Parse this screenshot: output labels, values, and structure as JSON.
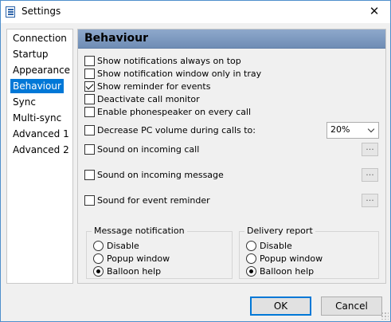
{
  "window": {
    "title": "Settings",
    "close_glyph": "✕"
  },
  "sidebar": {
    "items": [
      {
        "label": "Connection"
      },
      {
        "label": "Startup"
      },
      {
        "label": "Appearance"
      },
      {
        "label": "Behaviour",
        "selected": true
      },
      {
        "label": "Sync"
      },
      {
        "label": "Multi-sync"
      },
      {
        "label": "Advanced 1"
      },
      {
        "label": "Advanced 2"
      }
    ]
  },
  "section": {
    "title": "Behaviour"
  },
  "options": [
    {
      "label": "Show notifications always on top",
      "checked": false
    },
    {
      "label": "Show notification window only in tray",
      "checked": false
    },
    {
      "label": "Show reminder for events",
      "checked": true
    },
    {
      "label": "Deactivate call monitor",
      "checked": false
    },
    {
      "label": "Enable phonespeaker on every call",
      "checked": false
    },
    {
      "label": "Decrease PC volume during calls to:",
      "checked": false
    },
    {
      "label": "Sound on incoming call",
      "checked": false
    },
    {
      "label": "Sound on incoming message",
      "checked": false
    },
    {
      "label": "Sound for event reminder",
      "checked": false
    }
  ],
  "volume_select": {
    "value": "20%"
  },
  "browse_label": "...",
  "message_notification": {
    "title": "Message notification",
    "options": [
      "Disable",
      "Popup window",
      "Balloon help"
    ],
    "selected": "Balloon help"
  },
  "delivery_report": {
    "title": "Delivery report",
    "options": [
      "Disable",
      "Popup window",
      "Balloon help"
    ],
    "selected": "Balloon help"
  },
  "buttons": {
    "ok": "OK",
    "cancel": "Cancel"
  },
  "colors": {
    "selection": "#0078d7",
    "header": "#7e99c0"
  }
}
